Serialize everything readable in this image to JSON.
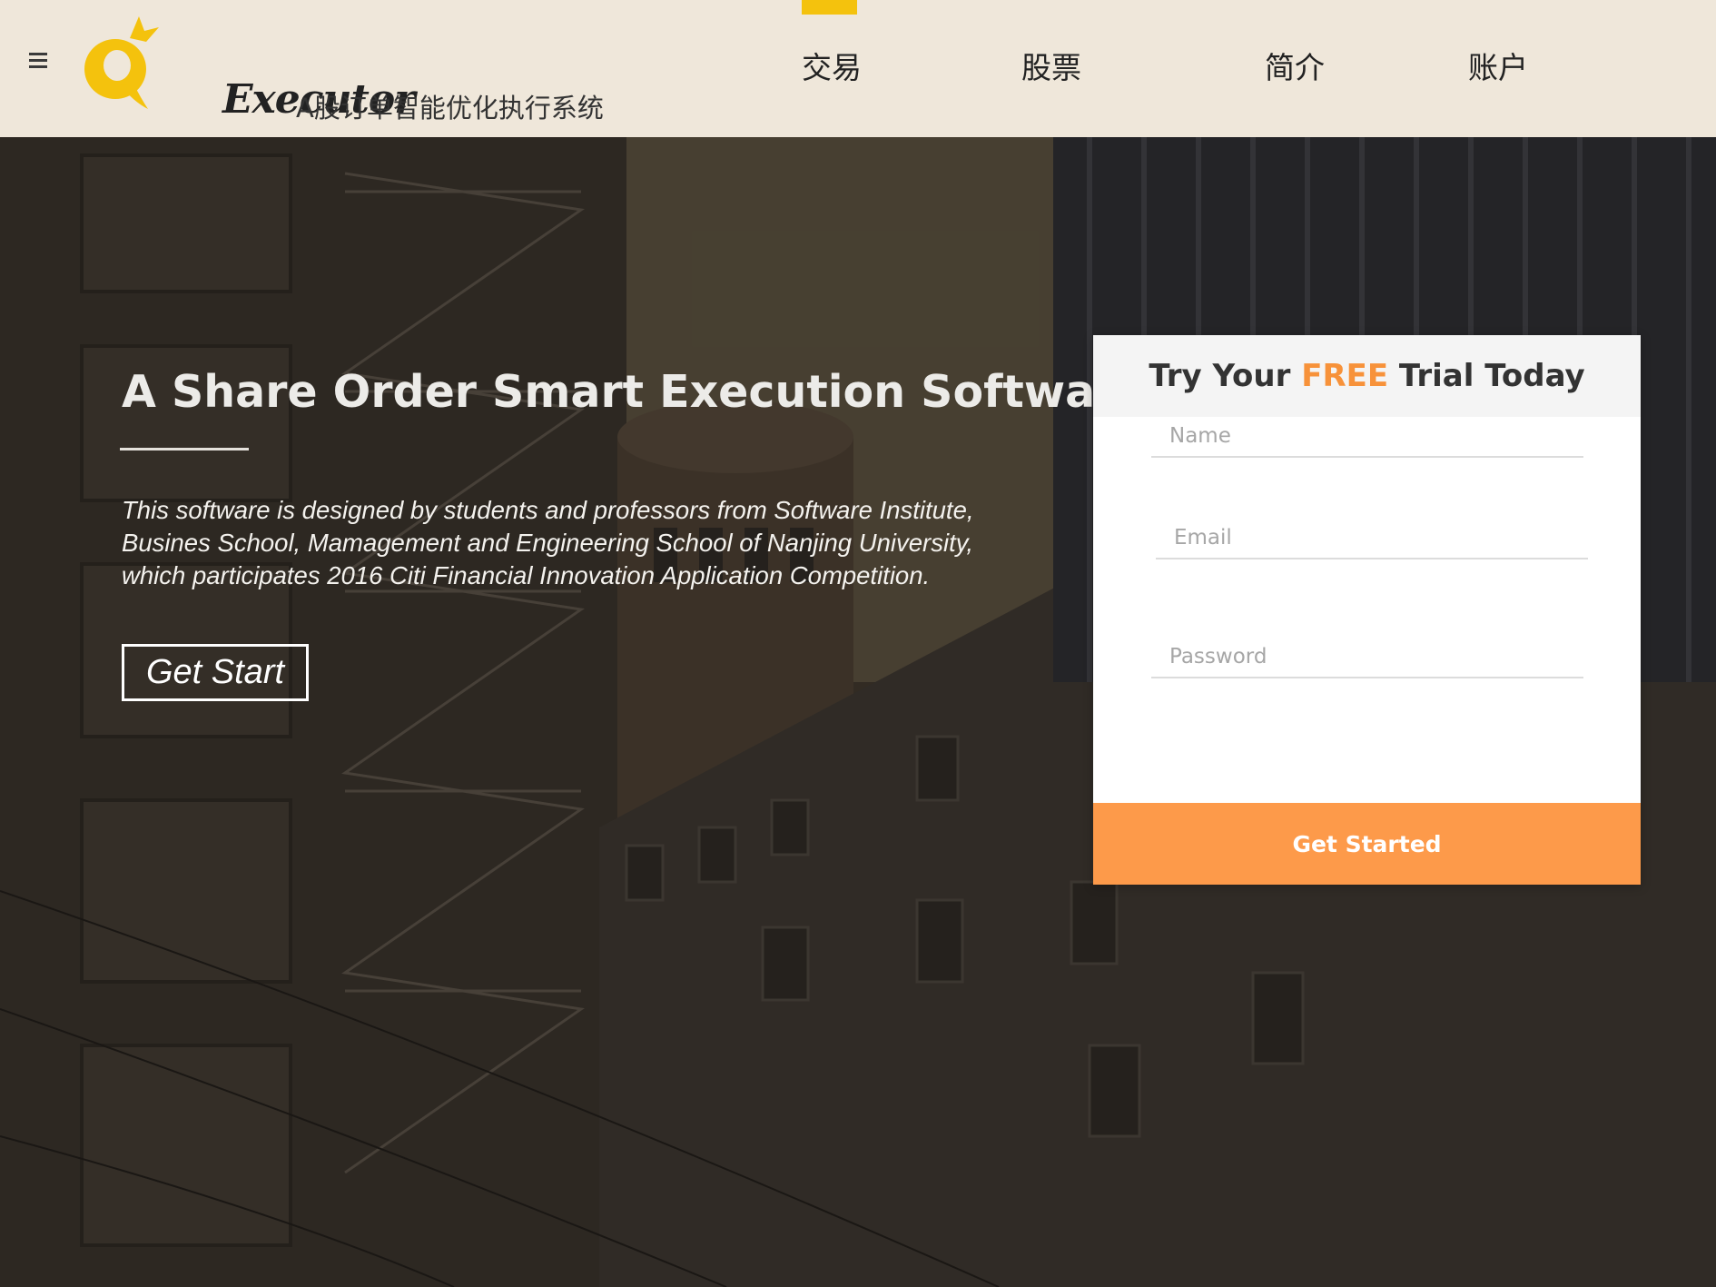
{
  "header": {
    "logo_text": "Executor",
    "tagline": "A股订单智能优化执行系统",
    "nav": [
      {
        "label": "交易",
        "active": true
      },
      {
        "label": "股票",
        "active": false
      },
      {
        "label": "简介",
        "active": false
      },
      {
        "label": "账户",
        "active": false
      }
    ]
  },
  "hero": {
    "title": "A Share Order Smart Execution Software",
    "description_lines": [
      "This software is designed by students and professors from Software Institute,",
      "Busines School, Mamagement and Engineering School of Nanjing University,",
      "which participates 2016 Citi Financial Innovation Application Competition."
    ],
    "cta_label": "Get Start"
  },
  "form": {
    "title_prefix": "Try Your ",
    "title_accent": "FREE",
    "title_suffix": " Trial Today",
    "name_placeholder": "Name",
    "email_placeholder": "Email",
    "password_placeholder": "Password",
    "submit_label": "Get Started"
  },
  "colors": {
    "header_bg": "#efe7da",
    "accent_yellow": "#f4c20d",
    "accent_orange": "#fd9a4a",
    "free_text": "#f7923a"
  },
  "icons": {
    "menu": "hamburger-menu-icon",
    "logo": "q-executor-logo"
  }
}
